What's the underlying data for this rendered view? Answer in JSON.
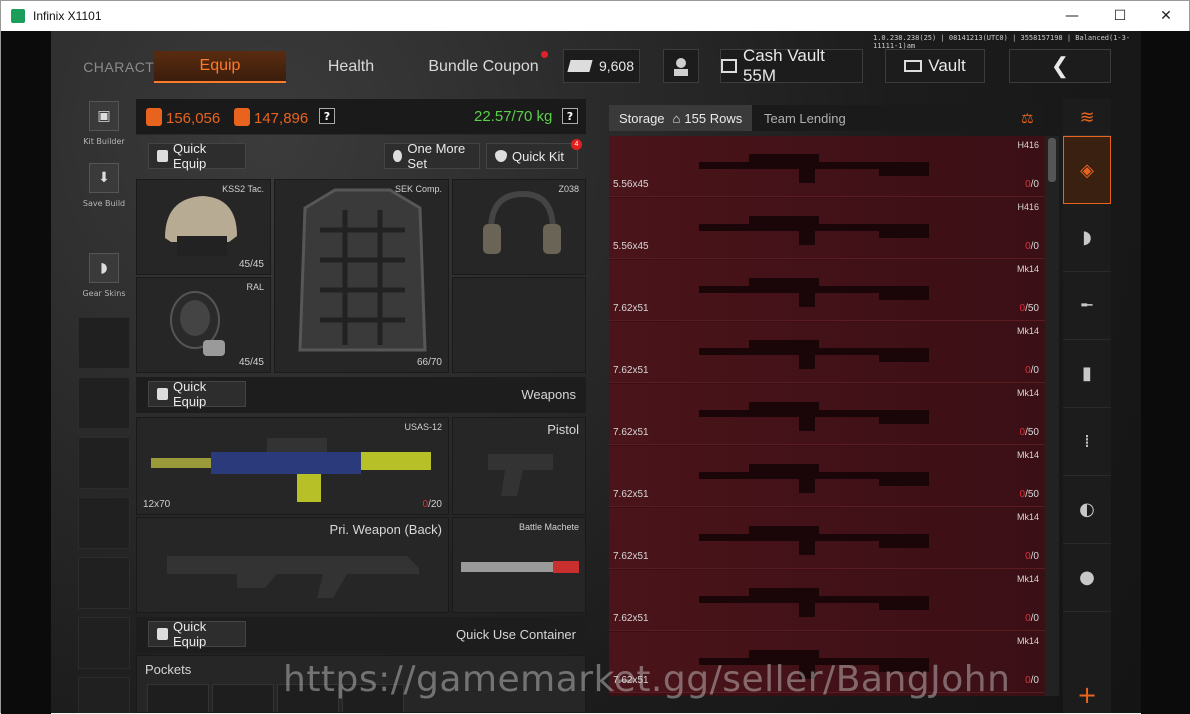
{
  "window": {
    "title": "Infinix X1101",
    "minimize": "—",
    "maximize": "☐",
    "close": "✕"
  },
  "version": "1.0.238.238(25) | 08141213(UTC0) | 3558157198 | Balanced(1-3-11111-1)am",
  "nav": {
    "character": "CHARACTER",
    "equip": "Equip",
    "health": "Health",
    "bundle": "Bundle Coupon"
  },
  "top": {
    "money": "9,608",
    "cash_vault": "Cash Vault 55M",
    "vault": "Vault",
    "back": "❮"
  },
  "leftbar": {
    "kit_builder": "Kit Builder",
    "save_build": "Save Build",
    "gear_skins": "Gear Skins"
  },
  "stats": {
    "value1": "156,056",
    "value2": "147,896",
    "weight": "22.57/70 kg",
    "help": "?"
  },
  "buttons": {
    "quick_equip": "Quick Equip",
    "one_more_set": "One More Set",
    "quick_kit": "Quick Kit",
    "quick_kit_badge": "4"
  },
  "gear": {
    "helmet": {
      "name": "KSS2 Tac.",
      "durability": "45/45"
    },
    "mask": {
      "name": "RAL",
      "durability": "45/45"
    },
    "armor": {
      "name": "SEK Comp.",
      "durability": "66/70"
    },
    "headset": {
      "name": "Z038"
    }
  },
  "weapons": {
    "section_title": "Weapons",
    "primary": {
      "name": "USAS-12",
      "ammo": "12x70",
      "mag_cur": "0",
      "mag_max": "/20"
    },
    "pistol": "Pistol",
    "back": "Pri. Weapon (Back)",
    "melee": "Battle Machete"
  },
  "quick_use": {
    "section_title": "Quick Use Container",
    "pockets": "Pockets"
  },
  "storage": {
    "tab": "Storage",
    "rows": "155 Rows",
    "team": "Team Lending",
    "items": [
      {
        "name": "H416",
        "caliber": "5.56x45",
        "cur": "0",
        "max": "/0"
      },
      {
        "name": "H416",
        "caliber": "5.56x45",
        "cur": "0",
        "max": "/0"
      },
      {
        "name": "Mk14",
        "caliber": "7.62x51",
        "cur": "0",
        "max": "/50"
      },
      {
        "name": "Mk14",
        "caliber": "7.62x51",
        "cur": "0",
        "max": "/0"
      },
      {
        "name": "Mk14",
        "caliber": "7.62x51",
        "cur": "0",
        "max": "/50"
      },
      {
        "name": "Mk14",
        "caliber": "7.62x51",
        "cur": "0",
        "max": "/50"
      },
      {
        "name": "Mk14",
        "caliber": "7.62x51",
        "cur": "0",
        "max": "/0"
      },
      {
        "name": "Mk14",
        "caliber": "7.62x51",
        "cur": "0",
        "max": "/0"
      },
      {
        "name": "Mk14",
        "caliber": "7.62x51",
        "cur": "0",
        "max": "/0"
      }
    ]
  },
  "watermark": "https://gamemarket.gg/seller/BangJohn",
  "colors": {
    "accent": "#e8641e",
    "weight_green": "#5bd04a",
    "ammo_red": "#e0303a"
  }
}
